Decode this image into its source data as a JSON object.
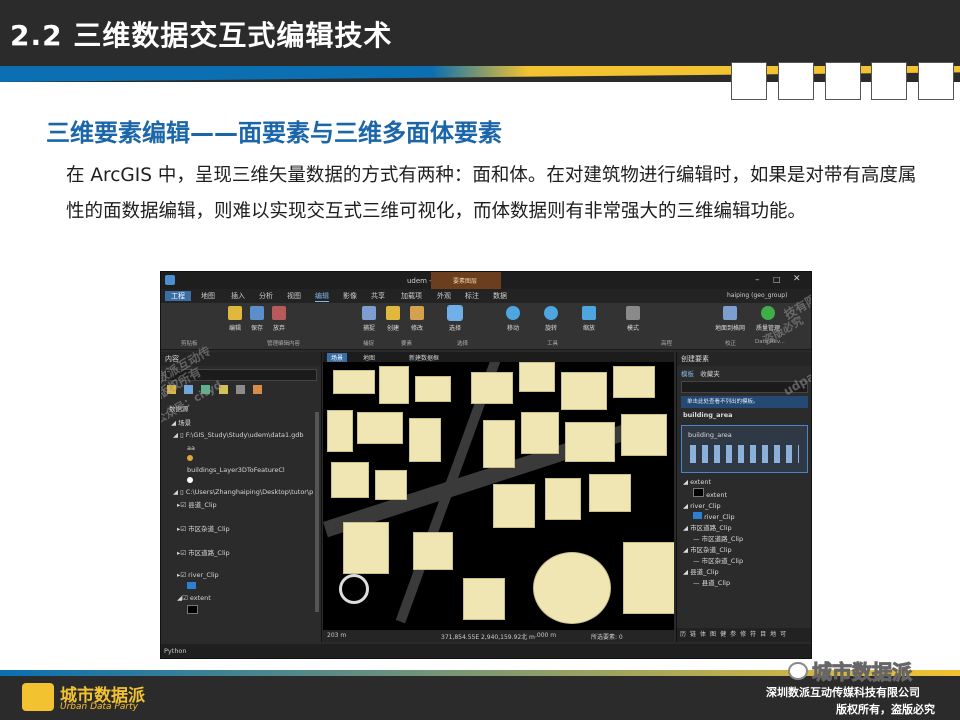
{
  "header": {
    "title": "2.2 三维数据交互式编辑技术",
    "nav_squares": 5
  },
  "subtitle": "三维要素编辑——面要素与三维多面体要素",
  "paragraph": "在 ArcGIS 中，呈现三维矢量数据的方式有两种：面和体。在对建筑物进行编辑时，如果是对带有高度属性的面数据编辑，则难以实现交互式三维可视化，而体数据则有非常强大的三维编辑功能。",
  "app": {
    "title": "udem - 场景 - ArcGIS Pro",
    "context_tab": "要素图层",
    "user": "haiping (geo_group)",
    "tabs": [
      "工程",
      "地图",
      "插入",
      "分析",
      "视图",
      "编辑",
      "影像",
      "共享",
      "加载项",
      "外观",
      "标注",
      "数据"
    ],
    "active_tab": "编辑",
    "ribbon_items": [
      "编辑",
      "保存",
      "放弃",
      "捕捉",
      "创建",
      "修改",
      "选择",
      "移动",
      "旋转",
      "缩放",
      "模式",
      "地面到格网",
      "质量管理"
    ],
    "ribbon_groups": [
      "剪贴板",
      "管理编辑内容",
      "捕捉",
      "要素",
      "选择",
      "工具",
      "高程",
      "校正",
      "Data Rev..."
    ],
    "contents": {
      "title": "内容",
      "search_placeholder": "搜索",
      "section": "数据源",
      "scene": "场景",
      "items": [
        "F:\\GIS_Study\\Study\\udem\\data1.gdb",
        "aa",
        "buildings_Layer3DToFeatureCl",
        "C:\\Users\\Zhanghaiping\\Desktop\\tutor\\p",
        "县道_Clip",
        "市区杂道_Clip",
        "市区道路_Clip",
        "river_Clip",
        "extent"
      ]
    },
    "map_tabs": [
      "场景",
      "地图",
      "新建数据框"
    ],
    "status": {
      "scale": "203 m",
      "coords": "371,854.55E 2,940,159.92北 m",
      "elev": ".000 m",
      "selected": "所选要素: 0"
    },
    "create_features": {
      "title": "创建要素",
      "tabs": [
        "模板",
        "收藏夹"
      ],
      "info": "单击此处查看不列出的模板。",
      "group": "building_area",
      "template": "building_area",
      "layers": [
        {
          "group": "extent",
          "item": "extent"
        },
        {
          "group": "river_Clip",
          "item": "river_Clip"
        },
        {
          "group": "市区道路_Clip",
          "item": "市区道路_Clip"
        },
        {
          "group": "市区杂道_Clip",
          "item": "市区杂道_Clip"
        },
        {
          "group": "县道_Clip",
          "item": "县道_Clip"
        }
      ],
      "bottom_tabs": [
        "历",
        "链",
        "体",
        "图",
        "健",
        "参",
        "修",
        "符",
        "目",
        "地",
        "可"
      ]
    },
    "python_label": "Python"
  },
  "watermark": {
    "line1": "深圳数派互动传",
    "line2": "版权所有",
    "line3": "公众号：cityd",
    "line4": "技有限公司",
    "line5": "盗版必究",
    "line6": "udparty"
  },
  "footer": {
    "logo_cn": "城市数据派",
    "logo_en": "Urban Data Party",
    "wechat_name": "城市数据派",
    "copyright1": "深圳数派互动传媒科技有限公司",
    "copyright2": "版权所有，盗版必究"
  },
  "colors": {
    "banner": "#2b2b2b",
    "accent_blue": "#1a66a8",
    "accent_yellow": "#f2c230",
    "building": "#efe6b4"
  }
}
